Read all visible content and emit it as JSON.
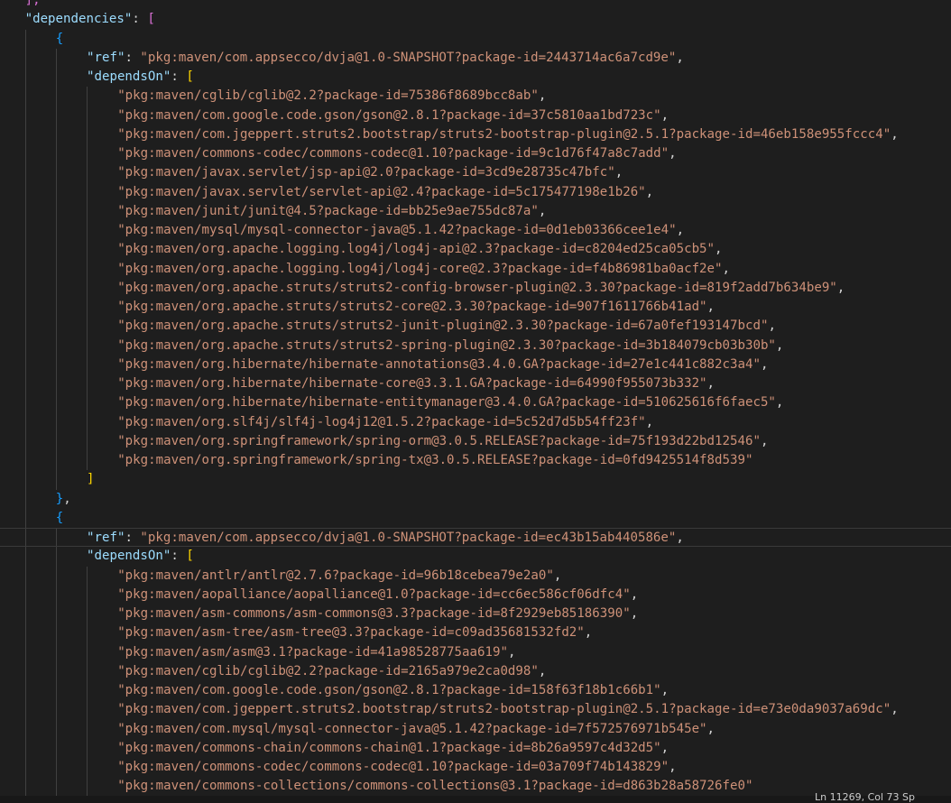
{
  "status": {
    "position": "Ln 11269, Col 73 Sp"
  },
  "lines": [
    {
      "indent": 1,
      "tokens": [
        {
          "t": "],",
          "c": "b2"
        }
      ]
    },
    {
      "indent": 1,
      "tokens": [
        {
          "t": "\"dependencies\"",
          "c": "key"
        },
        {
          "t": ": ",
          "c": "punc"
        },
        {
          "t": "[",
          "c": "b2"
        }
      ]
    },
    {
      "indent": 2,
      "tokens": [
        {
          "t": "{",
          "c": "b3"
        }
      ]
    },
    {
      "indent": 3,
      "tokens": [
        {
          "t": "\"ref\"",
          "c": "key"
        },
        {
          "t": ": ",
          "c": "punc"
        },
        {
          "t": "\"pkg:maven/com.appsecco/dvja@1.0-SNAPSHOT?package-id=2443714ac6a7cd9e\"",
          "c": "str"
        },
        {
          "t": ",",
          "c": "punc"
        }
      ]
    },
    {
      "indent": 3,
      "tokens": [
        {
          "t": "\"dependsOn\"",
          "c": "key"
        },
        {
          "t": ": ",
          "c": "punc"
        },
        {
          "t": "[",
          "c": "b1"
        }
      ]
    },
    {
      "indent": 4,
      "tokens": [
        {
          "t": "\"pkg:maven/cglib/cglib@2.2?package-id=75386f8689bcc8ab\"",
          "c": "str"
        },
        {
          "t": ",",
          "c": "punc"
        }
      ]
    },
    {
      "indent": 4,
      "tokens": [
        {
          "t": "\"pkg:maven/com.google.code.gson/gson@2.8.1?package-id=37c5810aa1bd723c\"",
          "c": "str"
        },
        {
          "t": ",",
          "c": "punc"
        }
      ]
    },
    {
      "indent": 4,
      "tokens": [
        {
          "t": "\"pkg:maven/com.jgeppert.struts2.bootstrap/struts2-bootstrap-plugin@2.5.1?package-id=46eb158e955fccc4\"",
          "c": "str"
        },
        {
          "t": ",",
          "c": "punc"
        }
      ]
    },
    {
      "indent": 4,
      "tokens": [
        {
          "t": "\"pkg:maven/commons-codec/commons-codec@1.10?package-id=9c1d76f47a8c7add\"",
          "c": "str"
        },
        {
          "t": ",",
          "c": "punc"
        }
      ]
    },
    {
      "indent": 4,
      "tokens": [
        {
          "t": "\"pkg:maven/javax.servlet/jsp-api@2.0?package-id=3cd9e28735c47bfc\"",
          "c": "str"
        },
        {
          "t": ",",
          "c": "punc"
        }
      ]
    },
    {
      "indent": 4,
      "tokens": [
        {
          "t": "\"pkg:maven/javax.servlet/servlet-api@2.4?package-id=5c175477198e1b26\"",
          "c": "str"
        },
        {
          "t": ",",
          "c": "punc"
        }
      ]
    },
    {
      "indent": 4,
      "tokens": [
        {
          "t": "\"pkg:maven/junit/junit@4.5?package-id=bb25e9ae755dc87a\"",
          "c": "str"
        },
        {
          "t": ",",
          "c": "punc"
        }
      ]
    },
    {
      "indent": 4,
      "tokens": [
        {
          "t": "\"pkg:maven/mysql/mysql-connector-java@5.1.42?package-id=0d1eb03366cee1e4\"",
          "c": "str"
        },
        {
          "t": ",",
          "c": "punc"
        }
      ]
    },
    {
      "indent": 4,
      "tokens": [
        {
          "t": "\"pkg:maven/org.apache.logging.log4j/log4j-api@2.3?package-id=c8204ed25ca05cb5\"",
          "c": "str"
        },
        {
          "t": ",",
          "c": "punc"
        }
      ]
    },
    {
      "indent": 4,
      "tokens": [
        {
          "t": "\"pkg:maven/org.apache.logging.log4j/log4j-core@2.3?package-id=f4b86981ba0acf2e\"",
          "c": "str"
        },
        {
          "t": ",",
          "c": "punc"
        }
      ]
    },
    {
      "indent": 4,
      "tokens": [
        {
          "t": "\"pkg:maven/org.apache.struts/struts2-config-browser-plugin@2.3.30?package-id=819f2add7b634be9\"",
          "c": "str"
        },
        {
          "t": ",",
          "c": "punc"
        }
      ]
    },
    {
      "indent": 4,
      "tokens": [
        {
          "t": "\"pkg:maven/org.apache.struts/struts2-core@2.3.30?package-id=907f1611766b41ad\"",
          "c": "str"
        },
        {
          "t": ",",
          "c": "punc"
        }
      ]
    },
    {
      "indent": 4,
      "tokens": [
        {
          "t": "\"pkg:maven/org.apache.struts/struts2-junit-plugin@2.3.30?package-id=67a0fef193147bcd\"",
          "c": "str"
        },
        {
          "t": ",",
          "c": "punc"
        }
      ]
    },
    {
      "indent": 4,
      "tokens": [
        {
          "t": "\"pkg:maven/org.apache.struts/struts2-spring-plugin@2.3.30?package-id=3b184079cb03b30b\"",
          "c": "str"
        },
        {
          "t": ",",
          "c": "punc"
        }
      ]
    },
    {
      "indent": 4,
      "tokens": [
        {
          "t": "\"pkg:maven/org.hibernate/hibernate-annotations@3.4.0.GA?package-id=27e1c441c882c3a4\"",
          "c": "str"
        },
        {
          "t": ",",
          "c": "punc"
        }
      ]
    },
    {
      "indent": 4,
      "tokens": [
        {
          "t": "\"pkg:maven/org.hibernate/hibernate-core@3.3.1.GA?package-id=64990f955073b332\"",
          "c": "str"
        },
        {
          "t": ",",
          "c": "punc"
        }
      ]
    },
    {
      "indent": 4,
      "tokens": [
        {
          "t": "\"pkg:maven/org.hibernate/hibernate-entitymanager@3.4.0.GA?package-id=510625616f6faec5\"",
          "c": "str"
        },
        {
          "t": ",",
          "c": "punc"
        }
      ]
    },
    {
      "indent": 4,
      "tokens": [
        {
          "t": "\"pkg:maven/org.slf4j/slf4j-log4j12@1.5.2?package-id=5c52d7d5b54ff23f\"",
          "c": "str"
        },
        {
          "t": ",",
          "c": "punc"
        }
      ]
    },
    {
      "indent": 4,
      "tokens": [
        {
          "t": "\"pkg:maven/org.springframework/spring-orm@3.0.5.RELEASE?package-id=75f193d22bd12546\"",
          "c": "str"
        },
        {
          "t": ",",
          "c": "punc"
        }
      ]
    },
    {
      "indent": 4,
      "tokens": [
        {
          "t": "\"pkg:maven/org.springframework/spring-tx@3.0.5.RELEASE?package-id=0fd9425514f8d539\"",
          "c": "str"
        }
      ]
    },
    {
      "indent": 3,
      "tokens": [
        {
          "t": "]",
          "c": "b1"
        }
      ]
    },
    {
      "indent": 2,
      "tokens": [
        {
          "t": "}",
          "c": "b3"
        },
        {
          "t": ",",
          "c": "punc"
        }
      ]
    },
    {
      "indent": 2,
      "tokens": [
        {
          "t": "{",
          "c": "b3"
        }
      ]
    },
    {
      "indent": 3,
      "current": true,
      "tokens": [
        {
          "t": "\"ref\"",
          "c": "key"
        },
        {
          "t": ": ",
          "c": "punc"
        },
        {
          "t": "\"pkg:maven/com.appsecco/dvja@1.0-SNAPSHOT?package-id=ec43b15ab440586e\"",
          "c": "str"
        },
        {
          "t": ",",
          "c": "punc"
        }
      ]
    },
    {
      "indent": 3,
      "tokens": [
        {
          "t": "\"dependsOn\"",
          "c": "key"
        },
        {
          "t": ": ",
          "c": "punc"
        },
        {
          "t": "[",
          "c": "b1"
        }
      ]
    },
    {
      "indent": 4,
      "tokens": [
        {
          "t": "\"pkg:maven/antlr/antlr@2.7.6?package-id=96b18cebea79e2a0\"",
          "c": "str"
        },
        {
          "t": ",",
          "c": "punc"
        }
      ]
    },
    {
      "indent": 4,
      "tokens": [
        {
          "t": "\"pkg:maven/aopalliance/aopalliance@1.0?package-id=cc6ec586cf06dfc4\"",
          "c": "str"
        },
        {
          "t": ",",
          "c": "punc"
        }
      ]
    },
    {
      "indent": 4,
      "tokens": [
        {
          "t": "\"pkg:maven/asm-commons/asm-commons@3.3?package-id=8f2929eb85186390\"",
          "c": "str"
        },
        {
          "t": ",",
          "c": "punc"
        }
      ]
    },
    {
      "indent": 4,
      "tokens": [
        {
          "t": "\"pkg:maven/asm-tree/asm-tree@3.3?package-id=c09ad35681532fd2\"",
          "c": "str"
        },
        {
          "t": ",",
          "c": "punc"
        }
      ]
    },
    {
      "indent": 4,
      "tokens": [
        {
          "t": "\"pkg:maven/asm/asm@3.1?package-id=41a98528775aa619\"",
          "c": "str"
        },
        {
          "t": ",",
          "c": "punc"
        }
      ]
    },
    {
      "indent": 4,
      "tokens": [
        {
          "t": "\"pkg:maven/cglib/cglib@2.2?package-id=2165a979e2ca0d98\"",
          "c": "str"
        },
        {
          "t": ",",
          "c": "punc"
        }
      ]
    },
    {
      "indent": 4,
      "tokens": [
        {
          "t": "\"pkg:maven/com.google.code.gson/gson@2.8.1?package-id=158f63f18b1c66b1\"",
          "c": "str"
        },
        {
          "t": ",",
          "c": "punc"
        }
      ]
    },
    {
      "indent": 4,
      "tokens": [
        {
          "t": "\"pkg:maven/com.jgeppert.struts2.bootstrap/struts2-bootstrap-plugin@2.5.1?package-id=e73e0da9037a69dc\"",
          "c": "str"
        },
        {
          "t": ",",
          "c": "punc"
        }
      ]
    },
    {
      "indent": 4,
      "tokens": [
        {
          "t": "\"pkg:maven/com.mysql/mysql-connector-java@5.1.42?package-id=7f572576971b545e\"",
          "c": "str"
        },
        {
          "t": ",",
          "c": "punc"
        }
      ]
    },
    {
      "indent": 4,
      "tokens": [
        {
          "t": "\"pkg:maven/commons-chain/commons-chain@1.1?package-id=8b26a9597c4d32d5\"",
          "c": "str"
        },
        {
          "t": ",",
          "c": "punc"
        }
      ]
    },
    {
      "indent": 4,
      "tokens": [
        {
          "t": "\"pkg:maven/commons-codec/commons-codec@1.10?package-id=03a709f74b143829\"",
          "c": "str"
        },
        {
          "t": ",",
          "c": "punc"
        }
      ]
    },
    {
      "indent": 4,
      "tokens": [
        {
          "t": "\"pkg:maven/commons-collections/commons-collections@3.1?package-id=d863b28a58726fe0\"",
          "c": "str"
        }
      ]
    }
  ]
}
